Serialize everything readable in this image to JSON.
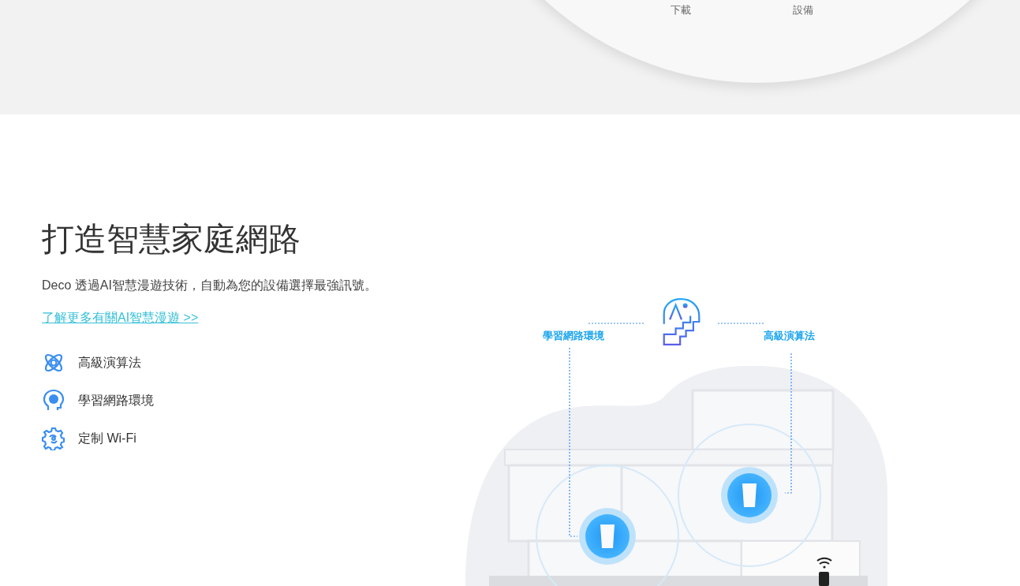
{
  "hero": {
    "captions": [
      "下載",
      "設備"
    ]
  },
  "section": {
    "title": "打造智慧家庭網路",
    "description": "Deco 透過AI智慧漫遊技術，自動為您的設備選擇最強訊號。",
    "link": "了解更多有關AI智慧漫遊 >>"
  },
  "features": [
    {
      "kind": "atom",
      "label": "高級演算法"
    },
    {
      "kind": "ai-head",
      "label": "學習網路環境"
    },
    {
      "kind": "gear-brain",
      "label": "定制 Wi-Fi"
    }
  ],
  "diagram": {
    "labels": [
      "學習網路環境",
      "高級演算法"
    ]
  }
}
